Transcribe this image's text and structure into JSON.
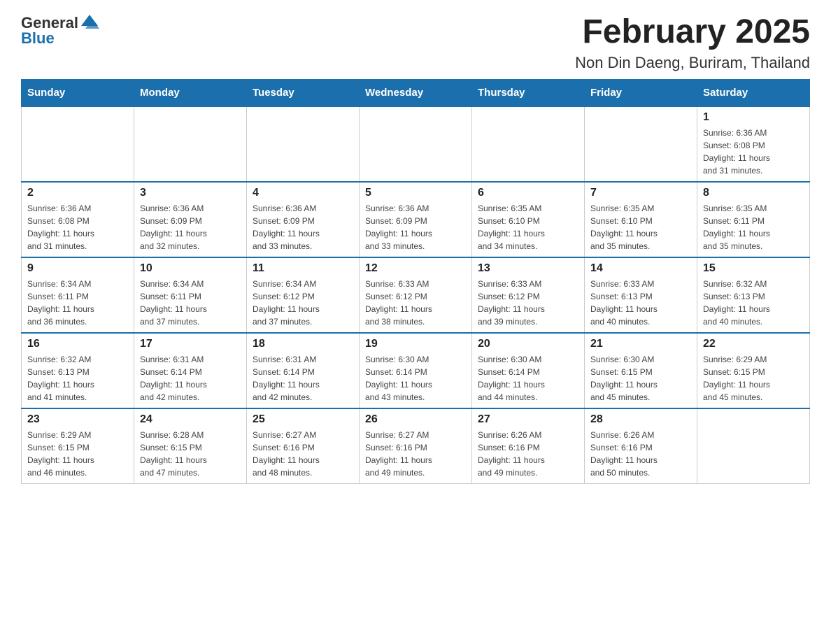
{
  "header": {
    "logo": {
      "general": "General",
      "blue": "Blue"
    },
    "title": "February 2025",
    "subtitle": "Non Din Daeng, Buriram, Thailand"
  },
  "days_of_week": [
    "Sunday",
    "Monday",
    "Tuesday",
    "Wednesday",
    "Thursday",
    "Friday",
    "Saturday"
  ],
  "weeks": [
    {
      "days": [
        {
          "number": "",
          "info": "",
          "empty": true
        },
        {
          "number": "",
          "info": "",
          "empty": true
        },
        {
          "number": "",
          "info": "",
          "empty": true
        },
        {
          "number": "",
          "info": "",
          "empty": true
        },
        {
          "number": "",
          "info": "",
          "empty": true
        },
        {
          "number": "",
          "info": "",
          "empty": true
        },
        {
          "number": "1",
          "info": "Sunrise: 6:36 AM\nSunset: 6:08 PM\nDaylight: 11 hours\nand 31 minutes.",
          "empty": false
        }
      ]
    },
    {
      "days": [
        {
          "number": "2",
          "info": "Sunrise: 6:36 AM\nSunset: 6:08 PM\nDaylight: 11 hours\nand 31 minutes.",
          "empty": false
        },
        {
          "number": "3",
          "info": "Sunrise: 6:36 AM\nSunset: 6:09 PM\nDaylight: 11 hours\nand 32 minutes.",
          "empty": false
        },
        {
          "number": "4",
          "info": "Sunrise: 6:36 AM\nSunset: 6:09 PM\nDaylight: 11 hours\nand 33 minutes.",
          "empty": false
        },
        {
          "number": "5",
          "info": "Sunrise: 6:36 AM\nSunset: 6:09 PM\nDaylight: 11 hours\nand 33 minutes.",
          "empty": false
        },
        {
          "number": "6",
          "info": "Sunrise: 6:35 AM\nSunset: 6:10 PM\nDaylight: 11 hours\nand 34 minutes.",
          "empty": false
        },
        {
          "number": "7",
          "info": "Sunrise: 6:35 AM\nSunset: 6:10 PM\nDaylight: 11 hours\nand 35 minutes.",
          "empty": false
        },
        {
          "number": "8",
          "info": "Sunrise: 6:35 AM\nSunset: 6:11 PM\nDaylight: 11 hours\nand 35 minutes.",
          "empty": false
        }
      ]
    },
    {
      "days": [
        {
          "number": "9",
          "info": "Sunrise: 6:34 AM\nSunset: 6:11 PM\nDaylight: 11 hours\nand 36 minutes.",
          "empty": false
        },
        {
          "number": "10",
          "info": "Sunrise: 6:34 AM\nSunset: 6:11 PM\nDaylight: 11 hours\nand 37 minutes.",
          "empty": false
        },
        {
          "number": "11",
          "info": "Sunrise: 6:34 AM\nSunset: 6:12 PM\nDaylight: 11 hours\nand 37 minutes.",
          "empty": false
        },
        {
          "number": "12",
          "info": "Sunrise: 6:33 AM\nSunset: 6:12 PM\nDaylight: 11 hours\nand 38 minutes.",
          "empty": false
        },
        {
          "number": "13",
          "info": "Sunrise: 6:33 AM\nSunset: 6:12 PM\nDaylight: 11 hours\nand 39 minutes.",
          "empty": false
        },
        {
          "number": "14",
          "info": "Sunrise: 6:33 AM\nSunset: 6:13 PM\nDaylight: 11 hours\nand 40 minutes.",
          "empty": false
        },
        {
          "number": "15",
          "info": "Sunrise: 6:32 AM\nSunset: 6:13 PM\nDaylight: 11 hours\nand 40 minutes.",
          "empty": false
        }
      ]
    },
    {
      "days": [
        {
          "number": "16",
          "info": "Sunrise: 6:32 AM\nSunset: 6:13 PM\nDaylight: 11 hours\nand 41 minutes.",
          "empty": false
        },
        {
          "number": "17",
          "info": "Sunrise: 6:31 AM\nSunset: 6:14 PM\nDaylight: 11 hours\nand 42 minutes.",
          "empty": false
        },
        {
          "number": "18",
          "info": "Sunrise: 6:31 AM\nSunset: 6:14 PM\nDaylight: 11 hours\nand 42 minutes.",
          "empty": false
        },
        {
          "number": "19",
          "info": "Sunrise: 6:30 AM\nSunset: 6:14 PM\nDaylight: 11 hours\nand 43 minutes.",
          "empty": false
        },
        {
          "number": "20",
          "info": "Sunrise: 6:30 AM\nSunset: 6:14 PM\nDaylight: 11 hours\nand 44 minutes.",
          "empty": false
        },
        {
          "number": "21",
          "info": "Sunrise: 6:30 AM\nSunset: 6:15 PM\nDaylight: 11 hours\nand 45 minutes.",
          "empty": false
        },
        {
          "number": "22",
          "info": "Sunrise: 6:29 AM\nSunset: 6:15 PM\nDaylight: 11 hours\nand 45 minutes.",
          "empty": false
        }
      ]
    },
    {
      "days": [
        {
          "number": "23",
          "info": "Sunrise: 6:29 AM\nSunset: 6:15 PM\nDaylight: 11 hours\nand 46 minutes.",
          "empty": false
        },
        {
          "number": "24",
          "info": "Sunrise: 6:28 AM\nSunset: 6:15 PM\nDaylight: 11 hours\nand 47 minutes.",
          "empty": false
        },
        {
          "number": "25",
          "info": "Sunrise: 6:27 AM\nSunset: 6:16 PM\nDaylight: 11 hours\nand 48 minutes.",
          "empty": false
        },
        {
          "number": "26",
          "info": "Sunrise: 6:27 AM\nSunset: 6:16 PM\nDaylight: 11 hours\nand 49 minutes.",
          "empty": false
        },
        {
          "number": "27",
          "info": "Sunrise: 6:26 AM\nSunset: 6:16 PM\nDaylight: 11 hours\nand 49 minutes.",
          "empty": false
        },
        {
          "number": "28",
          "info": "Sunrise: 6:26 AM\nSunset: 6:16 PM\nDaylight: 11 hours\nand 50 minutes.",
          "empty": false
        },
        {
          "number": "",
          "info": "",
          "empty": true
        }
      ]
    }
  ]
}
